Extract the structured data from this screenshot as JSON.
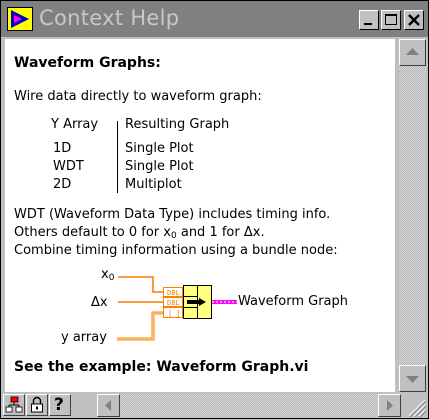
{
  "window": {
    "title": "Context Help",
    "buttons": {
      "minimize": "_",
      "maximize": "□",
      "close": "×"
    }
  },
  "help": {
    "heading": "Waveform Graphs:",
    "intro": "Wire data directly to waveform graph:",
    "table": {
      "headers": [
        "Y Array",
        "Resulting Graph"
      ],
      "rows": [
        [
          "1D",
          "Single Plot"
        ],
        [
          "WDT",
          "Single Plot"
        ],
        [
          "2D",
          "Multiplot"
        ]
      ]
    },
    "paragraph": {
      "line1": "WDT (Waveform Data Type) includes timing info.",
      "line2_a": "Others default to 0 for x",
      "line2_sub": "0",
      "line2_b": " and 1 for Δx.",
      "line3": "Combine timing information using a bundle node:"
    },
    "diagram": {
      "x0_label": "x",
      "x0_sub": "0",
      "dx_label": "Δx",
      "yarray_label": "y array",
      "output_label": "Waveform Graph",
      "dbl_label": "DBL",
      "array_label": "[ ]"
    },
    "example": "See the example: Waveform Graph.vi"
  },
  "colors": {
    "titlebar_bg": "#808080",
    "title_text": "#c8c8c8",
    "wire_orange": "#ff7f00",
    "wire_pink": "#ff00ff",
    "bundle_yellow": "#ffff80"
  },
  "toolbar": {
    "icons": [
      "hierarchy-icon",
      "lock-icon",
      "help-icon"
    ],
    "help_label": "?"
  }
}
